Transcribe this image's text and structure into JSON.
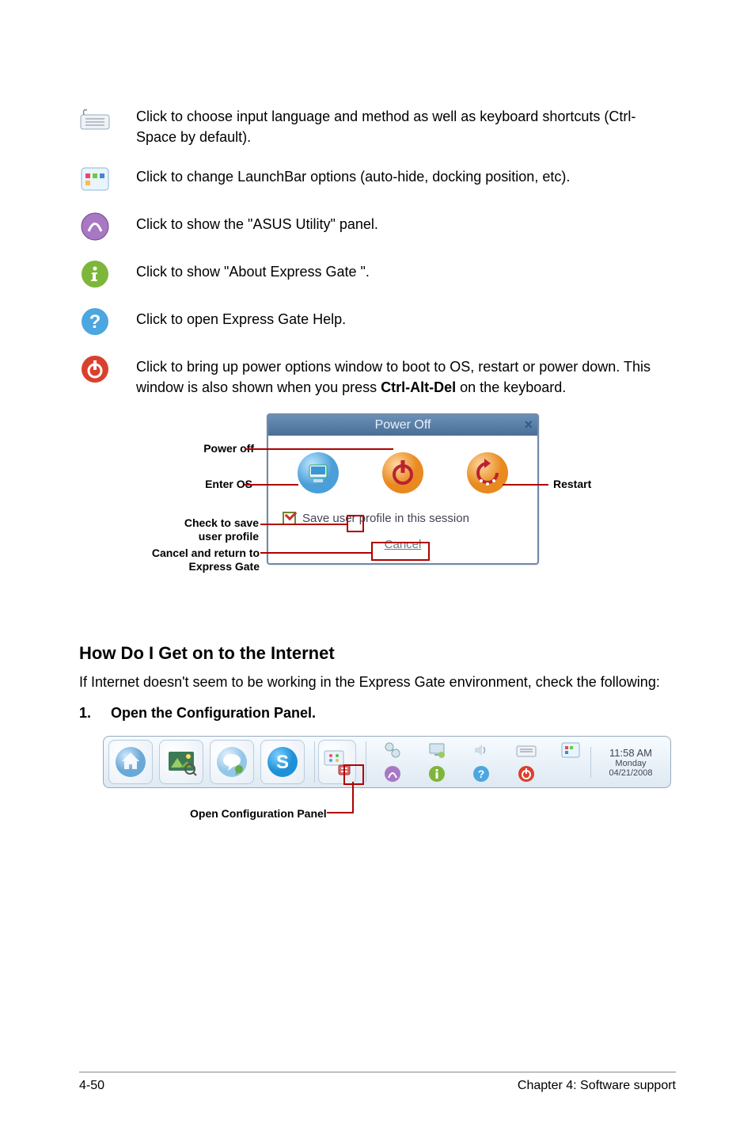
{
  "rows": [
    {
      "text": "Click to choose input language and method as well as keyboard shortcuts (Ctrl-Space by default)."
    },
    {
      "text": "Click to change LaunchBar options (auto-hide, docking position, etc)."
    },
    {
      "text": "Click to show the \"ASUS Utility\" panel."
    },
    {
      "text": "Click to show \"About Express Gate \"."
    },
    {
      "text": "Click to open Express Gate  Help."
    },
    {
      "text_html": "Click to bring up power options window to boot to OS, restart or power down. This window is also shown when you press <b>Ctrl-Alt-Del</b> on the keyboard."
    }
  ],
  "dialog": {
    "title": "Power Off",
    "save_label": "Save user profile in this session",
    "cancel_label": "Cancel"
  },
  "annotations": {
    "power_off": "Power off",
    "enter_os": "Enter OS",
    "check_save": "Check to save user profile",
    "cancel_return": "Cancel and return to Express Gate",
    "restart": "Restart",
    "open_config": "Open Configuration Panel"
  },
  "section": {
    "heading": "How Do I Get on to the Internet",
    "body": "If Internet doesn't seem to be working in the Express Gate  environment, check the following:",
    "step_num": "1.",
    "step_text": "Open the Configuration Panel."
  },
  "datetime": {
    "time": "11:58 AM",
    "day": "Monday",
    "date": "04/21/2008"
  },
  "footer": {
    "left": "4-50",
    "right": "Chapter 4: Software support"
  }
}
